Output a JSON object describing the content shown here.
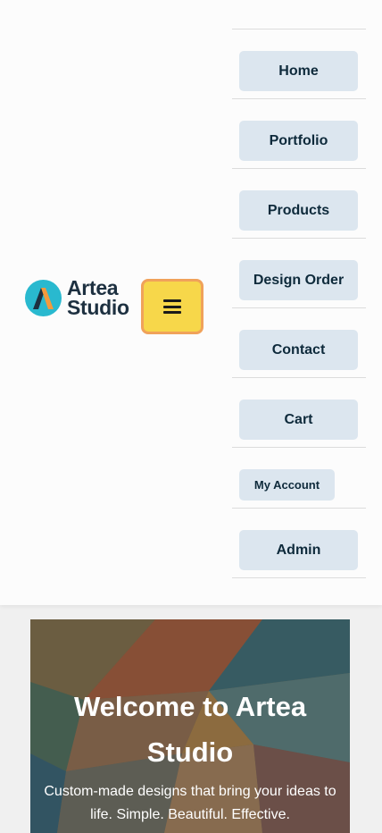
{
  "brand": {
    "name_line1": "Artea",
    "name_line2": "Studio",
    "logo_icon": "artea-a-logo",
    "logo_color": "#29b9cf"
  },
  "menu_toggle": {
    "icon": "hamburger-menu-icon",
    "bg_color": "#f7d74a",
    "border_color": "#f0a25a"
  },
  "nav": {
    "items": [
      {
        "label": "Home"
      },
      {
        "label": "Portfolio"
      },
      {
        "label": "Products"
      },
      {
        "label": "Design Order"
      },
      {
        "label": "Contact"
      },
      {
        "label": "Cart"
      },
      {
        "label": "My Account"
      },
      {
        "label": "Admin"
      }
    ],
    "button_color": "#dce6ef",
    "text_color": "#0e2a3b"
  },
  "hero": {
    "title": "Welcome to Artea Studio",
    "subtitle": "Custom-made designs that bring your ideas to life. Simple. Beautiful. Effective."
  }
}
